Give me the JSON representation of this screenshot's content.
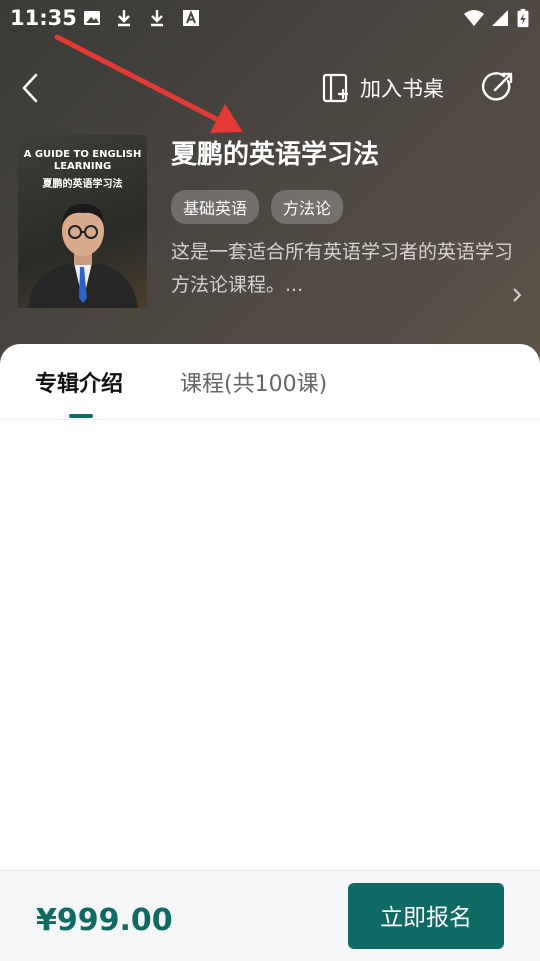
{
  "status_bar": {
    "time": "11:35"
  },
  "header": {
    "shelf_label": "加入书桌"
  },
  "course": {
    "cover_en": "A GUIDE TO ENGLISH LEARNING",
    "cover_cn": "夏鹏的英语学习法",
    "title": "夏鹏的英语学习法",
    "tags": [
      "基础英语",
      "方法论"
    ],
    "description": "这是一套适合所有英语学习者的英语学习方法论课程。..."
  },
  "tabs": [
    {
      "label": "专辑介绍",
      "active": true
    },
    {
      "label": "课程(共100课)",
      "active": false
    }
  ],
  "footer": {
    "price": "¥999.00",
    "enroll_label": "立即报名"
  },
  "colors": {
    "accent": "#0e6a63",
    "annotation_arrow": "#e53935"
  }
}
